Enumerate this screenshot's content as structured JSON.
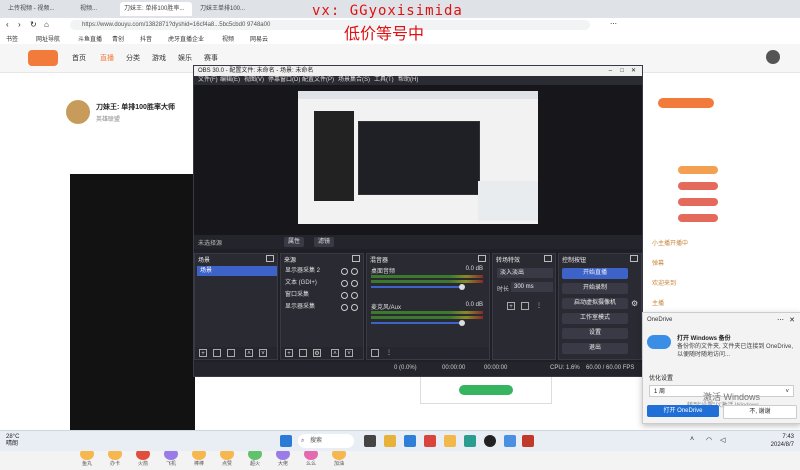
{
  "browser": {
    "tabs": [
      {
        "label": "上传视频 - 视频..."
      },
      {
        "label": "视频..."
      },
      {
        "label": "刀妹王: 单排100胜率..."
      },
      {
        "label": "刀妹王单排100..."
      }
    ],
    "url": "https://www.douyu.com/1382871?dyshid=16cf4a8...5bc5cbd0 9748a00",
    "bookmarks": [
      "书签",
      "网址导航",
      "斗鱼直播",
      "青创",
      "抖音",
      "虎牙直播企业",
      "视频",
      "网易云"
    ]
  },
  "watermark": {
    "line1": "vx: GGyoxisimida",
    "line2": "低价等号中"
  },
  "site": {
    "nav": [
      "首页",
      "直播",
      "分类",
      "游戏",
      "娱乐",
      "赛事"
    ],
    "streamer": {
      "name": "刀妹王: 单排100胜率大师",
      "sub": "英雄联盟"
    },
    "chat_badges": [
      "#f3a052",
      "#e46a5c",
      "#e46a5c",
      "#e46a5c"
    ],
    "chat_lines": [
      "小主播开播中",
      "弹幕",
      "欢迎来到",
      "主播",
      "新手"
    ],
    "gifts": [
      "鱼丸",
      "办卡",
      "火箭",
      "飞机",
      "棒棒",
      "点赞",
      "超火",
      "大佬",
      "么么",
      "加油"
    ]
  },
  "obs": {
    "title": "OBS 30.0 - 配置文件: 未命名 - 场景: 未命名",
    "menu": [
      "文件(F)",
      "编辑(E)",
      "视图(V)",
      "停靠窗口(D)",
      "配置文件(P)",
      "场景集合(S)",
      "工具(T)",
      "帮助(H)"
    ],
    "context": {
      "label": "未选择源",
      "properties": "属性",
      "filters": "滤镜"
    },
    "docks": {
      "scenes": "场景",
      "sources": "来源",
      "mixer": "混音器",
      "transitions": "转场特效",
      "controls": "控制按钮"
    },
    "scene_items": [
      "场景"
    ],
    "source_items": [
      "显示器采集 2",
      "文本 (GDI+)",
      "窗口采集",
      "显示器采集"
    ],
    "mixer": [
      {
        "name": "桌面音频",
        "db": "0.0 dB"
      },
      {
        "name": "麦克风/Aux",
        "db": "0.0 dB"
      }
    ],
    "transition": {
      "type": "淡入淡出",
      "duration": "300 ms",
      "label": "时长"
    },
    "controls": [
      "开始直播",
      "开始录制",
      "启动虚拟摄像机",
      "工作室模式",
      "设置",
      "退出"
    ],
    "status": {
      "frames": "0 (0.0%)",
      "live": "00:00:00",
      "rec": "00:00:00",
      "cpu": "CPU: 1.6%",
      "fps": "60.00 / 60.00 FPS"
    }
  },
  "notification": {
    "app": "OneDrive",
    "title": "打开 Windows 备份",
    "body": "备份你的文件夹, 文件夹已连接到 OneDrive, 以便随时随地访问...",
    "setting_label": "优化设置",
    "dropdown": "1 周",
    "activate": "激活 Windows",
    "activate_sub": "转到\"设置\"以激活 Windows。",
    "btn_open": "打开 OneDrive",
    "btn_no": "不, 谢谢"
  },
  "taskbar": {
    "weather_temp": "28°C",
    "weather_text": "晴朗",
    "search": "搜索",
    "time": "7:43",
    "date": "2024/8/7"
  }
}
